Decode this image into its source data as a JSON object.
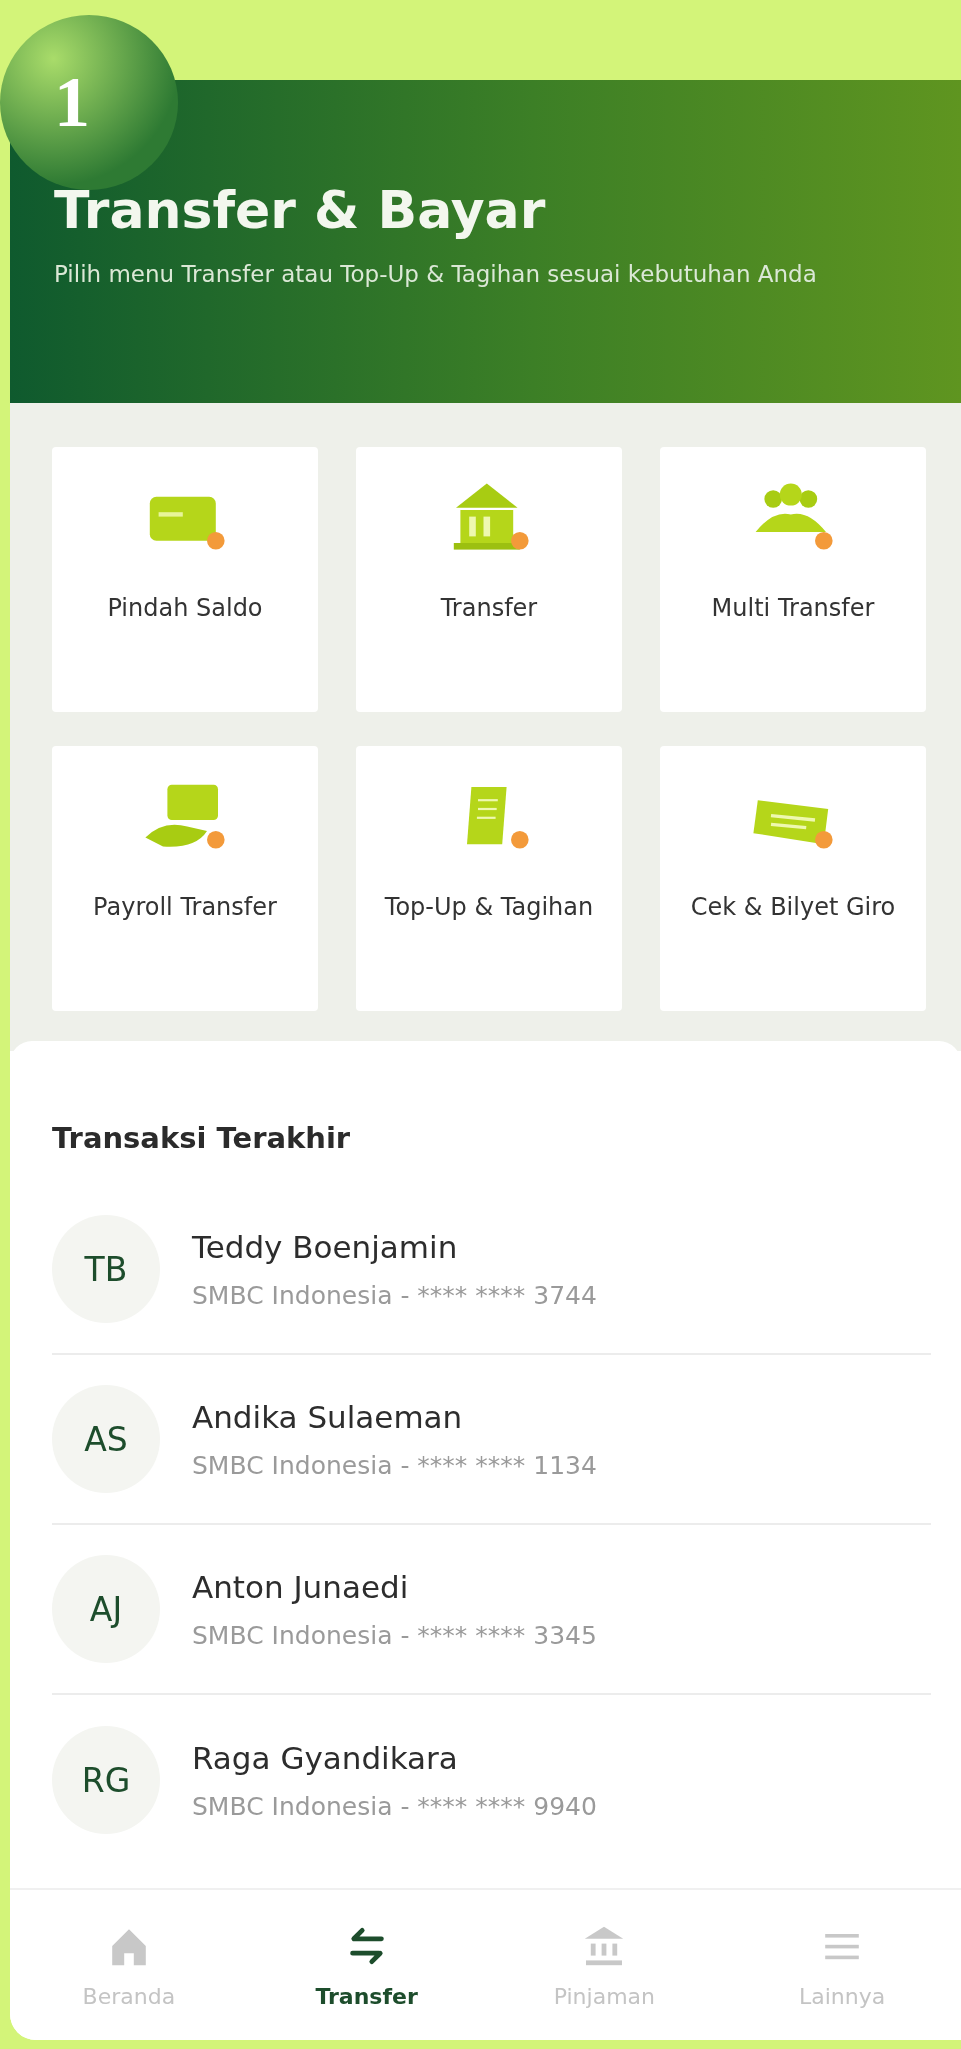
{
  "step_badge": "1",
  "header": {
    "title": "Transfer & Bayar",
    "subtitle": "Pilih menu Transfer atau Top-Up & Tagihan sesuai kebutuhan Anda"
  },
  "menu": [
    {
      "kind": "card",
      "label": "Pindah Saldo"
    },
    {
      "kind": "bank",
      "label": "Transfer"
    },
    {
      "kind": "people",
      "label": "Multi Transfer"
    },
    {
      "kind": "payroll",
      "label": "Payroll Transfer"
    },
    {
      "kind": "bill",
      "label": "Top-Up & Tagihan"
    },
    {
      "kind": "cheque",
      "label": "Cek & Bilyet Giro"
    }
  ],
  "recent": {
    "title": "Transaksi Terakhir",
    "items": [
      {
        "initials": "TB",
        "name": "Teddy Boenjamin",
        "account": "SMBC Indonesia - **** **** 3744"
      },
      {
        "initials": "AS",
        "name": "Andika Sulaeman",
        "account": "SMBC Indonesia - **** **** 1134"
      },
      {
        "initials": "AJ",
        "name": "Anton Junaedi",
        "account": "SMBC Indonesia - **** **** 3345"
      },
      {
        "initials": "RG",
        "name": "Raga Gyandikara",
        "account": "SMBC Indonesia - **** **** 9940"
      }
    ]
  },
  "nav": [
    {
      "kind": "home",
      "label": "Beranda",
      "selected": false
    },
    {
      "kind": "transfer",
      "label": "Transfer",
      "selected": true
    },
    {
      "kind": "bank",
      "label": "Pinjaman",
      "selected": false
    },
    {
      "kind": "menu",
      "label": "Lainnya",
      "selected": false
    }
  ]
}
